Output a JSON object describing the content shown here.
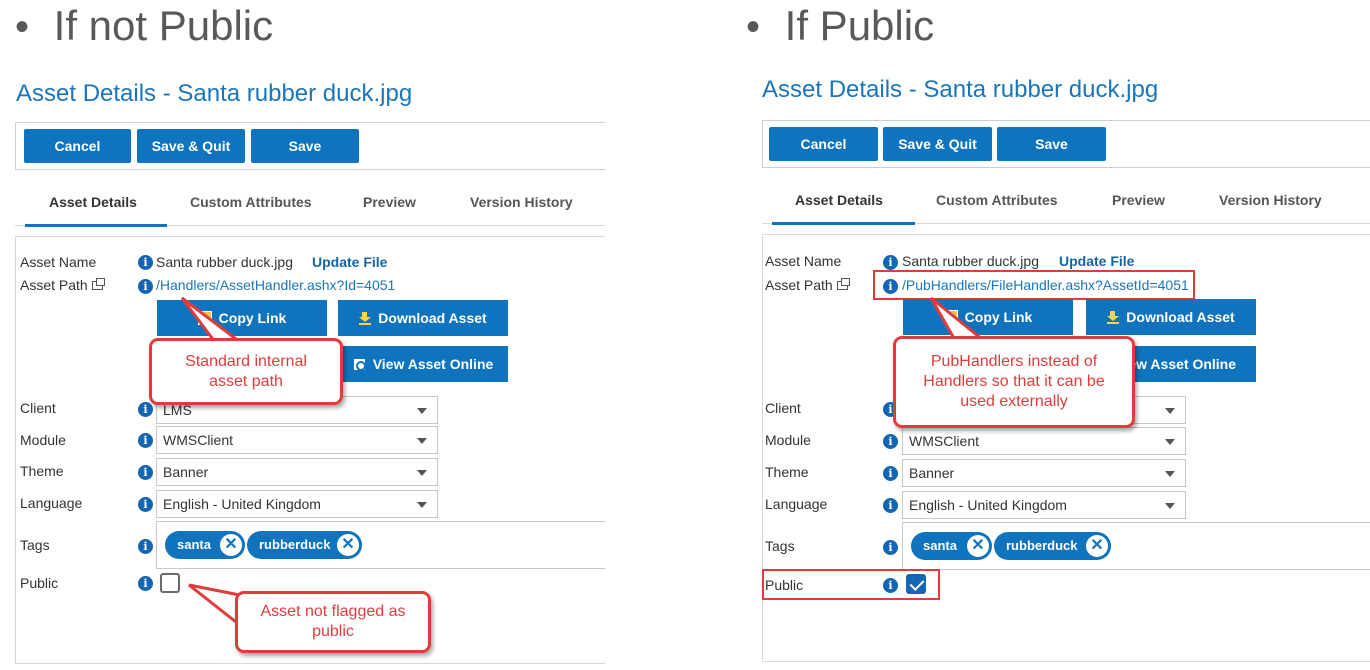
{
  "left": {
    "heading": "If not Public",
    "title": "Asset Details - Santa rubber duck.jpg",
    "toolbar": {
      "cancel": "Cancel",
      "save_quit": "Save & Quit",
      "save": "Save"
    },
    "tabs": [
      "Asset Details",
      "Custom Attributes",
      "Preview",
      "Version History"
    ],
    "asset_name_label": "Asset Name",
    "asset_name": "Santa rubber duck.jpg",
    "update_file": "Update File",
    "asset_path_label": "Asset Path",
    "asset_path": "/Handlers/AssetHandler.ashx?Id=4051",
    "copy_link": "Copy Link",
    "download_asset": "Download Asset",
    "view_asset_online": "View Asset Online",
    "client_label": "Client",
    "client_value": "LMS",
    "module_label": "Module",
    "module_value": "WMSClient",
    "theme_label": "Theme",
    "theme_value": "Banner",
    "language_label": "Language",
    "language_value": "English - United Kingdom",
    "tags_label": "Tags",
    "tags": [
      "santa",
      "rubberduck"
    ],
    "public_label": "Public",
    "public_checked": false,
    "callout_path": "Standard internal asset path",
    "callout_public": "Asset not flagged as public"
  },
  "right": {
    "heading": "If Public",
    "title": "Asset Details - Santa rubber duck.jpg",
    "toolbar": {
      "cancel": "Cancel",
      "save_quit": "Save & Quit",
      "save": "Save"
    },
    "tabs": [
      "Asset Details",
      "Custom Attributes",
      "Preview",
      "Version History"
    ],
    "asset_name_label": "Asset Name",
    "asset_name": "Santa rubber duck.jpg",
    "update_file": "Update File",
    "asset_path_label": "Asset Path",
    "asset_path": "/PubHandlers/FileHandler.ashx?AssetId=4051",
    "copy_link": "Copy Link",
    "download_asset": "Download Asset",
    "view_asset_online_partial": "ew Asset Online",
    "client_label": "Client",
    "module_label": "Module",
    "module_value": "WMSClient",
    "theme_label": "Theme",
    "theme_value": "Banner",
    "language_label": "Language",
    "language_value": "English - United Kingdom",
    "tags_label": "Tags",
    "tags": [
      "santa",
      "rubberduck"
    ],
    "public_label": "Public",
    "public_checked": true,
    "callout_path": "PubHandlers instead of Handlers so that it can be used externally"
  },
  "colors": {
    "accent": "#0f74bd",
    "link": "#1b75bb",
    "annotation": "#e03c3c"
  }
}
